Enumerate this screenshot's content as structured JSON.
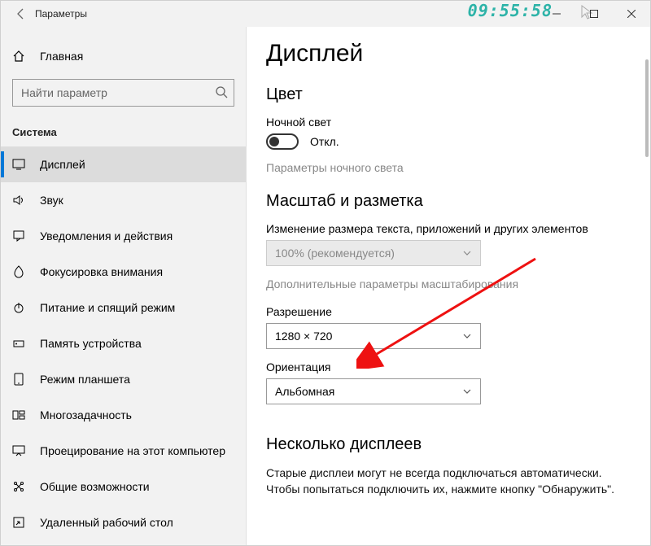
{
  "window": {
    "title": "Параметры"
  },
  "clock": "09:55:58",
  "sidebar": {
    "home": "Главная",
    "search_placeholder": "Найти параметр",
    "group": "Система",
    "items": [
      {
        "label": "Дисплей",
        "icon": "display-icon",
        "selected": true
      },
      {
        "label": "Звук",
        "icon": "sound-icon"
      },
      {
        "label": "Уведомления и действия",
        "icon": "notifications-icon"
      },
      {
        "label": "Фокусировка внимания",
        "icon": "focus-icon"
      },
      {
        "label": "Питание и спящий режим",
        "icon": "power-icon"
      },
      {
        "label": "Память устройства",
        "icon": "storage-icon"
      },
      {
        "label": "Режим планшета",
        "icon": "tablet-icon"
      },
      {
        "label": "Многозадачность",
        "icon": "multitask-icon"
      },
      {
        "label": "Проецирование на этот компьютер",
        "icon": "projection-icon"
      },
      {
        "label": "Общие возможности",
        "icon": "shared-icon"
      },
      {
        "label": "Удаленный рабочий стол",
        "icon": "remote-icon"
      }
    ]
  },
  "content": {
    "page_title": "Дисплей",
    "color_section": "Цвет",
    "night_light_label": "Ночной свет",
    "toggle_state": "Откл.",
    "night_light_settings": "Параметры ночного света",
    "scale_section": "Масштаб и разметка",
    "scale_label": "Изменение размера текста, приложений и других элементов",
    "scale_value": "100% (рекомендуется)",
    "advanced_scale": "Дополнительные параметры масштабирования",
    "resolution_label": "Разрешение",
    "resolution_value": "1280 × 720",
    "orientation_label": "Ориентация",
    "orientation_value": "Альбомная",
    "multi_section": "Несколько дисплеев",
    "multi_para": "Старые дисплеи могут не всегда подключаться автоматически. Чтобы попытаться подключить их, нажмите кнопку \"Обнаружить\"."
  }
}
